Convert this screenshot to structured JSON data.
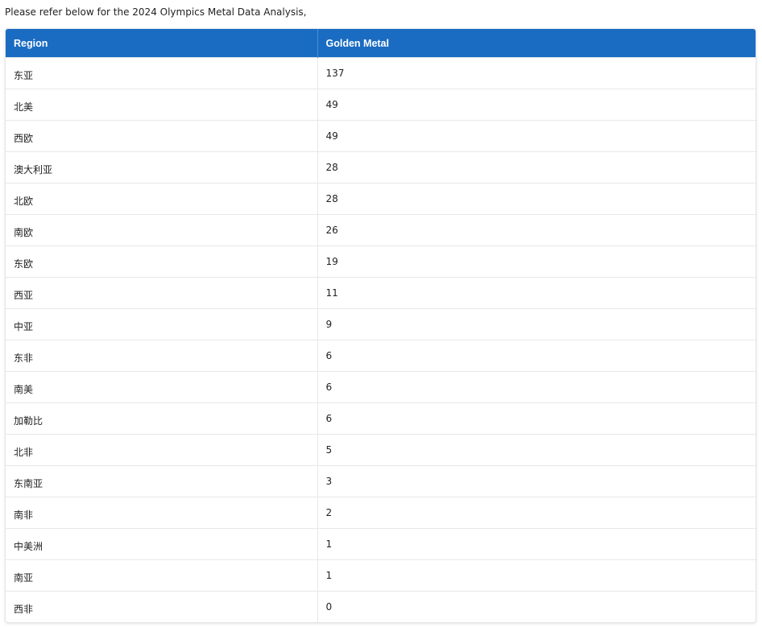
{
  "intro_text": "Please refer below for the 2024 Olympics Metal Data Analysis,",
  "table": {
    "columns": [
      "Region",
      "Golden Metal"
    ],
    "header_color": "#1a6cc2",
    "rows": [
      {
        "region": "东亚",
        "gold": "137"
      },
      {
        "region": "北美",
        "gold": "49"
      },
      {
        "region": "西欧",
        "gold": "49"
      },
      {
        "region": "澳大利亚",
        "gold": "28"
      },
      {
        "region": "北欧",
        "gold": "28"
      },
      {
        "region": "南欧",
        "gold": "26"
      },
      {
        "region": "东欧",
        "gold": "19"
      },
      {
        "region": "西亚",
        "gold": "11"
      },
      {
        "region": "中亚",
        "gold": "9"
      },
      {
        "region": "东非",
        "gold": "6"
      },
      {
        "region": "南美",
        "gold": "6"
      },
      {
        "region": "加勒比",
        "gold": "6"
      },
      {
        "region": "北非",
        "gold": "5"
      },
      {
        "region": "东南亚",
        "gold": "3"
      },
      {
        "region": "南非",
        "gold": "2"
      },
      {
        "region": "中美洲",
        "gold": "1"
      },
      {
        "region": "南亚",
        "gold": "1"
      },
      {
        "region": "西非",
        "gold": "0"
      }
    ]
  }
}
